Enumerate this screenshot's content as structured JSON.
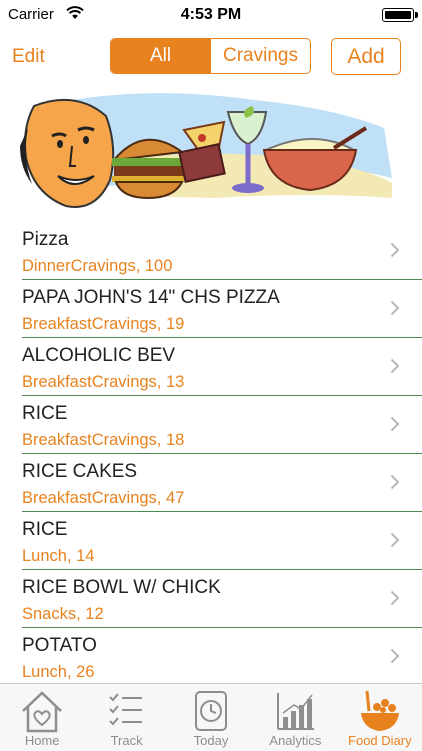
{
  "status_bar": {
    "carrier": "Carrier",
    "time": "4:53 PM"
  },
  "nav": {
    "edit": "Edit",
    "segments": [
      "All",
      "Cravings"
    ],
    "selected_segment": "All",
    "add": "Add"
  },
  "items": [
    {
      "title": "Pizza",
      "subtitle": "DinnerCravings, 100"
    },
    {
      "title": "PAPA JOHN'S 14\" CHS PIZZA",
      "subtitle": "BreakfastCravings, 19"
    },
    {
      "title": "ALCOHOLIC BEV",
      "subtitle": "BreakfastCravings, 13"
    },
    {
      "title": "RICE",
      "subtitle": "BreakfastCravings, 18"
    },
    {
      "title": "RICE CAKES",
      "subtitle": "BreakfastCravings, 47"
    },
    {
      "title": "RICE",
      "subtitle": "Lunch, 14"
    },
    {
      "title": "RICE BOWL W/ CHICK",
      "subtitle": "Snacks, 12"
    },
    {
      "title": "POTATO",
      "subtitle": "Lunch, 26"
    }
  ],
  "tabs": [
    {
      "label": "Home",
      "icon": "home-icon"
    },
    {
      "label": "Track",
      "icon": "checklist-icon"
    },
    {
      "label": "Today",
      "icon": "clock-icon"
    },
    {
      "label": "Analytics",
      "icon": "bar-chart-icon"
    },
    {
      "label": "Food Diary",
      "icon": "food-bowl-icon"
    }
  ],
  "active_tab": "Food Diary",
  "colors": {
    "accent": "#e8821e",
    "divider": "#4a8a4a",
    "tab_inactive": "#8e8e8e"
  }
}
